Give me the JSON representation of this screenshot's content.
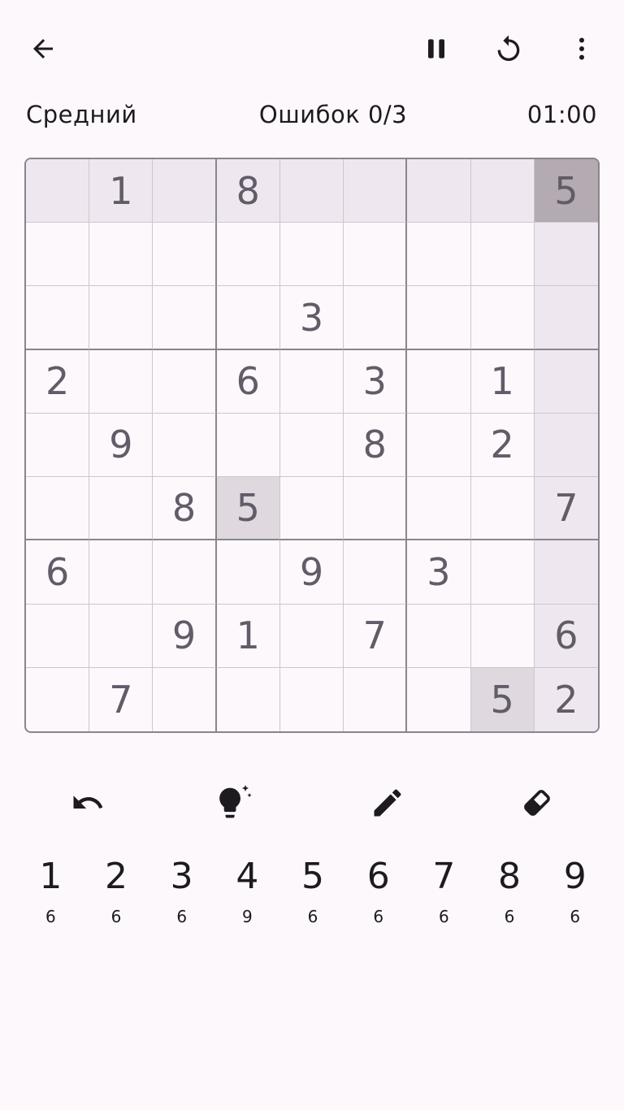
{
  "header": {
    "back_icon": "arrow-back-icon",
    "pause_icon": "pause-icon",
    "restart_icon": "restart-icon",
    "more_icon": "more-vert-icon"
  },
  "status": {
    "difficulty": "Средний",
    "mistakes": "Ошибок 0/3",
    "timer": "01:00"
  },
  "board": {
    "selected_cell": [
      0,
      8
    ],
    "rows": [
      [
        "",
        "1",
        "",
        "8",
        "",
        "",
        "",
        "",
        "5"
      ],
      [
        "",
        "",
        "",
        "",
        "",
        "",
        "",
        "",
        ""
      ],
      [
        "",
        "",
        "",
        "",
        "3",
        "",
        "",
        "",
        ""
      ],
      [
        "2",
        "",
        "",
        "6",
        "",
        "3",
        "",
        "1",
        ""
      ],
      [
        "",
        "9",
        "",
        "",
        "",
        "8",
        "",
        "2",
        ""
      ],
      [
        "",
        "",
        "8",
        "5",
        "",
        "",
        "",
        "",
        "7"
      ],
      [
        "6",
        "",
        "",
        "",
        "9",
        "",
        "3",
        "",
        ""
      ],
      [
        "",
        "",
        "9",
        "1",
        "",
        "7",
        "",
        "",
        "6"
      ],
      [
        "",
        "7",
        "",
        "",
        "",
        "",
        "",
        "5",
        "2"
      ]
    ]
  },
  "tools": [
    {
      "name": "undo",
      "icon": "undo-icon"
    },
    {
      "name": "hint",
      "icon": "lightbulb-sparkle-icon"
    },
    {
      "name": "pencil",
      "icon": "pencil-icon"
    },
    {
      "name": "eraser",
      "icon": "eraser-icon"
    }
  ],
  "numpad": [
    {
      "num": "1",
      "count": "6"
    },
    {
      "num": "2",
      "count": "6"
    },
    {
      "num": "3",
      "count": "6"
    },
    {
      "num": "4",
      "count": "9"
    },
    {
      "num": "5",
      "count": "6"
    },
    {
      "num": "6",
      "count": "6"
    },
    {
      "num": "7",
      "count": "6"
    },
    {
      "num": "8",
      "count": "6"
    },
    {
      "num": "9",
      "count": "6"
    }
  ],
  "colors": {
    "background": "#fdf8fc",
    "digit": "#625b68",
    "highlight": "#eee7ef",
    "same_number": "#dfd8df",
    "selected": "#b3aab2",
    "grid_thick": "#8a848c",
    "grid_thin": "#cdc6cf"
  }
}
